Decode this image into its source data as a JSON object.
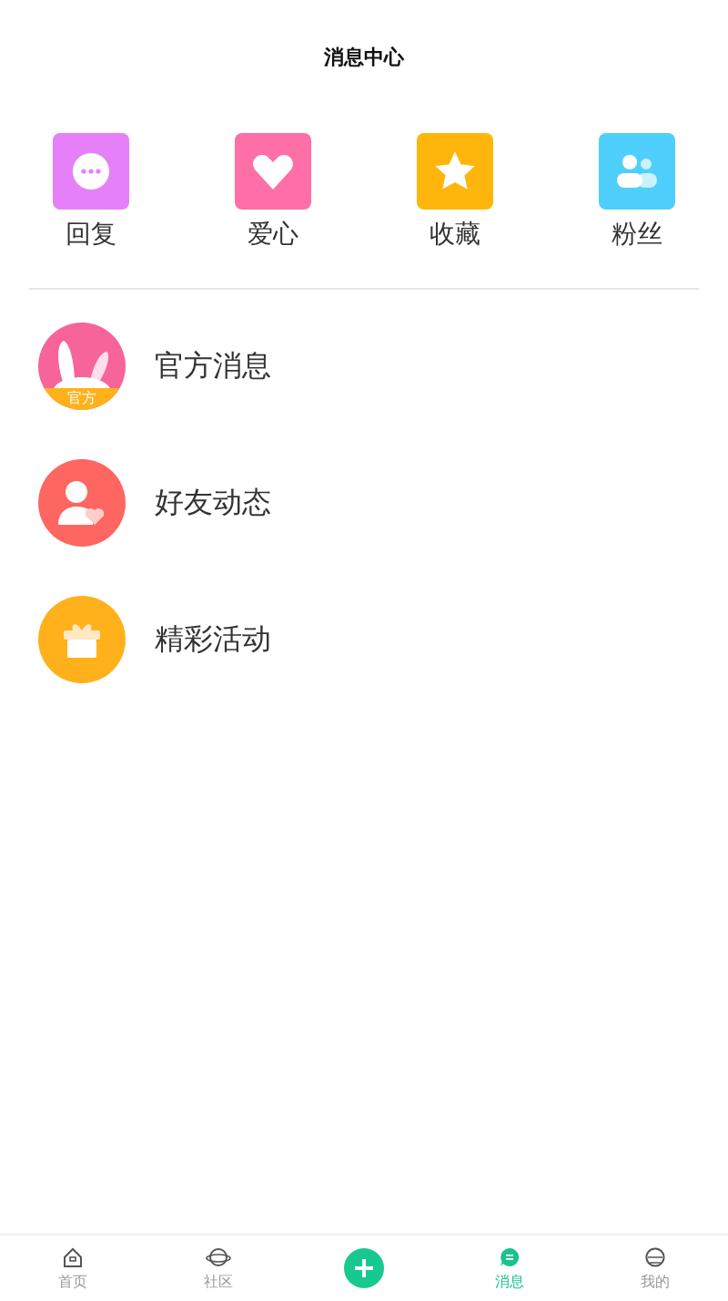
{
  "header": {
    "title": "消息中心"
  },
  "quick_actions": [
    {
      "label": "回复",
      "kind": "chat",
      "color": "#e580f8"
    },
    {
      "label": "爱心",
      "kind": "heart",
      "color": "#fd6fa6"
    },
    {
      "label": "收藏",
      "kind": "star",
      "color": "#ffb60c"
    },
    {
      "label": "粉丝",
      "kind": "fans",
      "color": "#4fcffc"
    }
  ],
  "messages": [
    {
      "title": "官方消息",
      "kind": "official",
      "badge": "官方",
      "color": "#f7649a"
    },
    {
      "title": "好友动态",
      "kind": "friend",
      "color": "#fe6661"
    },
    {
      "title": "精彩活动",
      "kind": "gift",
      "color": "#ffb11b"
    }
  ],
  "tab_bar": [
    {
      "label": "首页",
      "kind": "home",
      "selected": false
    },
    {
      "label": "社区",
      "kind": "planet",
      "selected": false
    },
    {
      "kind": "add",
      "selected": false
    },
    {
      "label": "消息",
      "kind": "message",
      "selected": true
    },
    {
      "label": "我的",
      "kind": "profile",
      "selected": false
    }
  ]
}
